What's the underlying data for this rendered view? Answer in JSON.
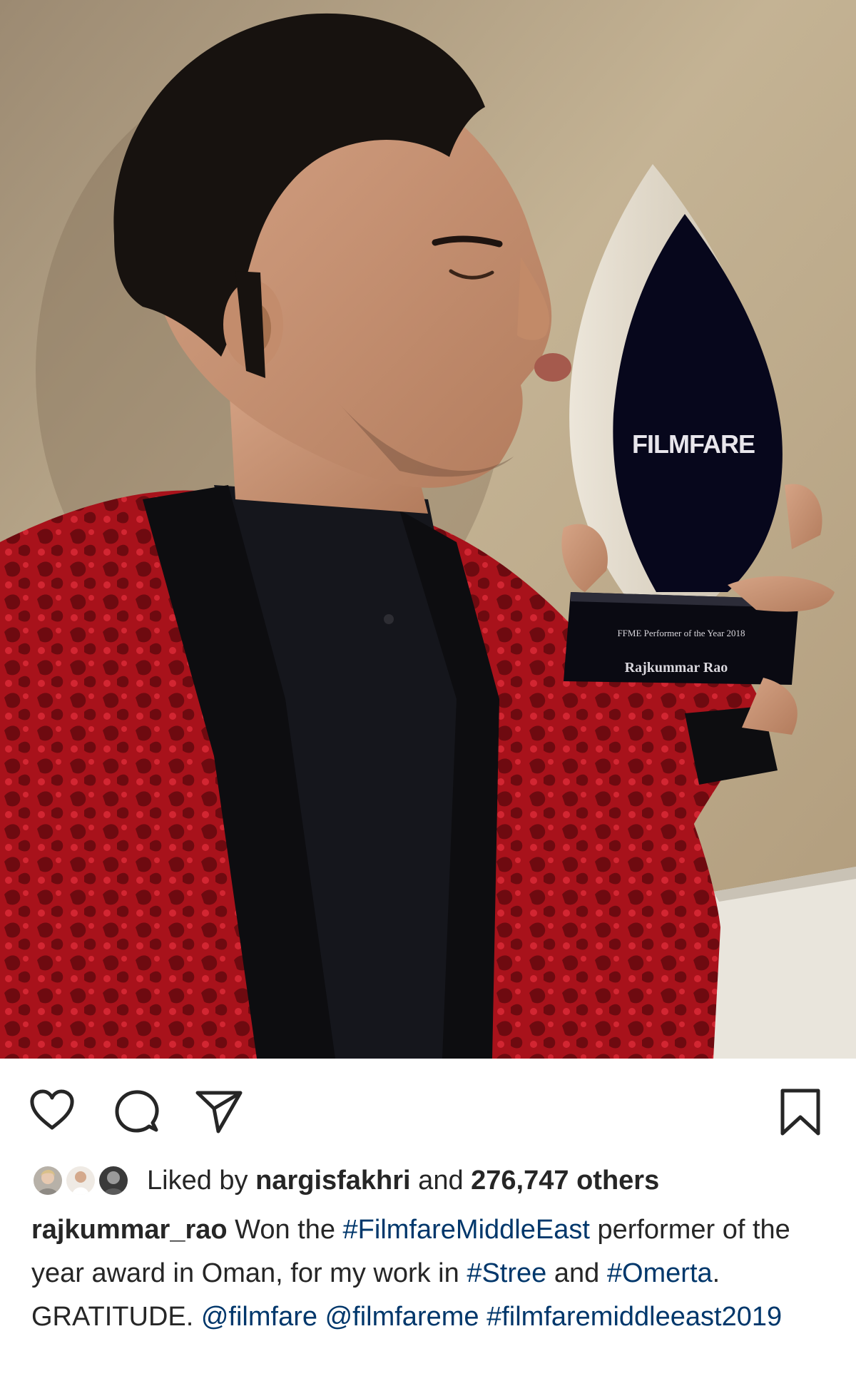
{
  "photo": {
    "trophy_brand": "FILMFARE",
    "trophy_award_line": "FFME Performer of the Year 2018",
    "trophy_name_plate": "Rajkummar Rao"
  },
  "actions": {
    "like_icon": "heart-icon",
    "comment_icon": "comment-bubble-icon",
    "share_icon": "paper-plane-icon",
    "save_icon": "bookmark-icon"
  },
  "likes": {
    "prefix": "Liked by ",
    "first_user": "nargisfakhri",
    "connector": " and ",
    "count_text": "276,747 others"
  },
  "caption": {
    "username": "rajkummar_rao",
    "t1": " Won the ",
    "h1": "#FilmfareMiddleEast",
    "t2": " performer of the year award in Oman, for my work in ",
    "h2": "#Stree",
    "t3": " and ",
    "h3": "#Omerta",
    "t4": ". GRATITUDE. ",
    "m1": "@filmfare",
    "t5": " ",
    "m2": "@filmfareme",
    "t6": " ",
    "h4": "#filmfaremiddleeast2019"
  },
  "colors": {
    "link": "#00376b",
    "text": "#262626",
    "background": "#ffffff"
  }
}
